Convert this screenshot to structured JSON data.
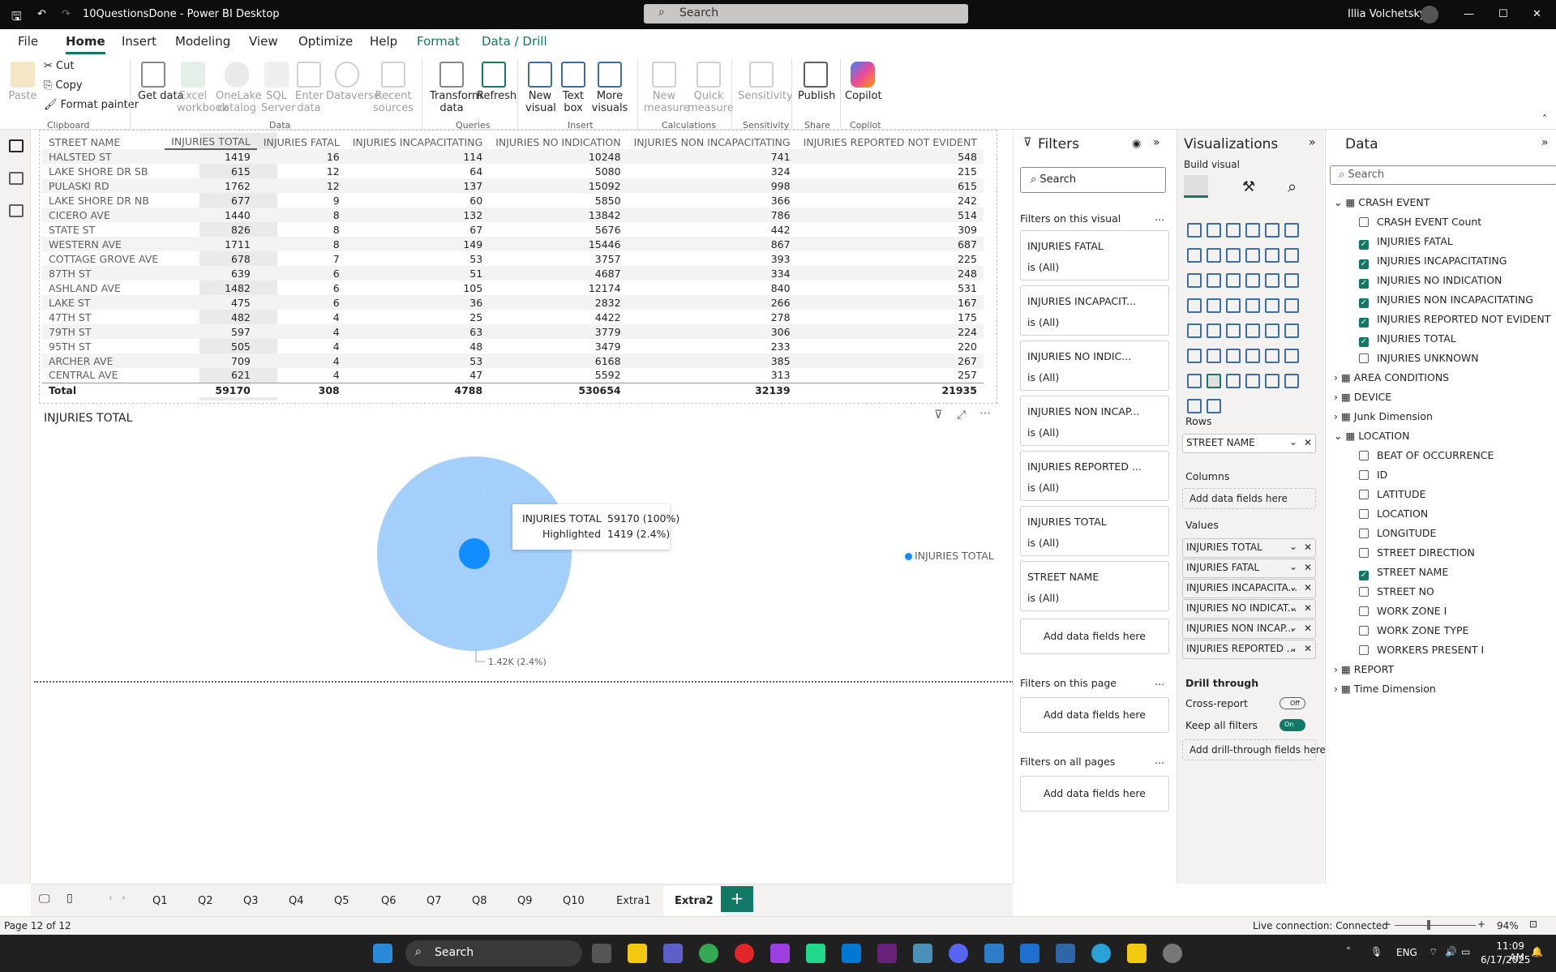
{
  "app": {
    "title": "10QuestionsDone - Power BI Desktop",
    "search": "Search",
    "user": "Illia Volchetskyi"
  },
  "ribbon_tabs": [
    "File",
    "Home",
    "Insert",
    "Modeling",
    "View",
    "Optimize",
    "Help",
    "Format",
    "Data / Drill"
  ],
  "ribbon": {
    "clipboard": {
      "paste": "Paste",
      "cut": "Cut",
      "copy": "Copy",
      "format_painter": "Format painter",
      "label": "Clipboard"
    },
    "data": {
      "get_data": "Get data",
      "excel": "Excel workbook",
      "onelake": "OneLake catalog",
      "sql": "SQL Server",
      "enter": "Enter data",
      "dataverse": "Dataverse",
      "recent": "Recent sources",
      "label": "Data"
    },
    "queries": {
      "transform": "Transform data",
      "refresh": "Refresh",
      "label": "Queries"
    },
    "insert": {
      "new_visual": "New visual",
      "text_box": "Text box",
      "more_visuals": "More visuals",
      "label": "Insert"
    },
    "calc": {
      "new_measure": "New measure",
      "quick_measure": "Quick measure",
      "label": "Calculations"
    },
    "sensitivity": {
      "btn": "Sensitivity",
      "label": "Sensitivity"
    },
    "share": {
      "publish": "Publish",
      "label": "Share"
    },
    "copilot": {
      "btn": "Copilot",
      "label": "Copilot"
    }
  },
  "table": {
    "headers": [
      "STREET NAME",
      "INJURIES TOTAL",
      "INJURIES FATAL",
      "INJURIES INCAPACITATING",
      "INJURIES NO INDICATION",
      "INJURIES NON INCAPACITATING",
      "INJURIES REPORTED NOT EVIDENT"
    ],
    "rows": [
      [
        "HALSTED ST",
        "1419",
        "16",
        "114",
        "10248",
        "741",
        "548"
      ],
      [
        "LAKE SHORE DR SB",
        "615",
        "12",
        "64",
        "5080",
        "324",
        "215"
      ],
      [
        "PULASKI RD",
        "1762",
        "12",
        "137",
        "15092",
        "998",
        "615"
      ],
      [
        "LAKE SHORE DR NB",
        "677",
        "9",
        "60",
        "5850",
        "366",
        "242"
      ],
      [
        "CICERO AVE",
        "1440",
        "8",
        "132",
        "13842",
        "786",
        "514"
      ],
      [
        "STATE ST",
        "826",
        "8",
        "67",
        "5676",
        "442",
        "309"
      ],
      [
        "WESTERN AVE",
        "1711",
        "8",
        "149",
        "15446",
        "867",
        "687"
      ],
      [
        "COTTAGE GROVE AVE",
        "678",
        "7",
        "53",
        "3757",
        "393",
        "225"
      ],
      [
        "87TH ST",
        "639",
        "6",
        "51",
        "4687",
        "334",
        "248"
      ],
      [
        "ASHLAND AVE",
        "1482",
        "6",
        "105",
        "12174",
        "840",
        "531"
      ],
      [
        "LAKE ST",
        "475",
        "6",
        "36",
        "2832",
        "266",
        "167"
      ],
      [
        "47TH ST",
        "482",
        "4",
        "25",
        "4422",
        "278",
        "175"
      ],
      [
        "79TH ST",
        "597",
        "4",
        "63",
        "3779",
        "306",
        "224"
      ],
      [
        "95TH ST",
        "505",
        "4",
        "48",
        "3479",
        "233",
        "220"
      ],
      [
        "ARCHER AVE",
        "709",
        "4",
        "53",
        "6168",
        "385",
        "267"
      ],
      [
        "CENTRAL AVE",
        "621",
        "4",
        "47",
        "5592",
        "313",
        "257"
      ]
    ],
    "total": [
      "Total",
      "59170",
      "308",
      "4788",
      "530654",
      "32139",
      "21935"
    ]
  },
  "pie": {
    "title": "INJURIES TOTAL",
    "legend": "INJURIES TOTAL",
    "tooltip": {
      "k1": "INJURIES TOTAL",
      "v1": "59170 (100%)",
      "k2": "Highlighted",
      "v2": "1419 (2.4%)"
    },
    "data_label": "1.42K (2.4%)",
    "colors": {
      "base": "#a3cffa",
      "highlight": "#118dff"
    }
  },
  "chart_data": {
    "type": "pie",
    "title": "INJURIES TOTAL",
    "total": 59170,
    "highlighted": 1419,
    "highlighted_pct": 2.4
  },
  "filters": {
    "title": "Filters",
    "search": "Search",
    "on_visual": "Filters on this visual",
    "cards": [
      {
        "name": "INJURIES FATAL",
        "value": "is (All)"
      },
      {
        "name": "INJURIES INCAPACIT...",
        "value": "is (All)"
      },
      {
        "name": "INJURIES NO INDIC...",
        "value": "is (All)"
      },
      {
        "name": "INJURIES NON INCAP...",
        "value": "is (All)"
      },
      {
        "name": "INJURIES REPORTED ...",
        "value": "is (All)"
      },
      {
        "name": "INJURIES TOTAL",
        "value": "is (All)"
      },
      {
        "name": "STREET NAME",
        "value": "is (All)"
      }
    ],
    "add": "Add data fields here",
    "on_page": "Filters on this page",
    "on_all": "Filters on all pages",
    "more": "..."
  },
  "viz": {
    "title": "Visualizations",
    "build": "Build visual",
    "rows_label": "Rows",
    "rows_field": "STREET NAME",
    "columns_label": "Columns",
    "add": "Add data fields here",
    "values_label": "Values",
    "values": [
      "INJURIES TOTAL",
      "INJURIES FATAL",
      "INJURIES INCAPACITA...",
      "INJURIES NO INDICAT...",
      "INJURIES NON INCAP...",
      "INJURIES REPORTED ..."
    ],
    "drill": "Drill through",
    "cross": "Cross-report",
    "cross_state": "Off",
    "keep": "Keep all filters",
    "keep_state": "On",
    "add_drill": "Add drill-through fields here"
  },
  "data_pane": {
    "title": "Data",
    "search": "Search",
    "tables": [
      {
        "name": "CRASH EVENT",
        "expanded": true,
        "fields": [
          {
            "name": "CRASH EVENT Count",
            "checked": false
          },
          {
            "name": "INJURIES FATAL",
            "checked": true
          },
          {
            "name": "INJURIES INCAPACITATING",
            "checked": true
          },
          {
            "name": "INJURIES NO INDICATION",
            "checked": true
          },
          {
            "name": "INJURIES NON INCAPACITATING",
            "checked": true
          },
          {
            "name": "INJURIES REPORTED NOT EVIDENT",
            "checked": true
          },
          {
            "name": "INJURIES TOTAL",
            "checked": true
          },
          {
            "name": "INJURIES UNKNOWN",
            "checked": false
          }
        ]
      },
      {
        "name": "AREA CONDITIONS",
        "expanded": false
      },
      {
        "name": "DEVICE",
        "expanded": false
      },
      {
        "name": "Junk Dimension",
        "expanded": false
      },
      {
        "name": "LOCATION",
        "expanded": true,
        "fields": [
          {
            "name": "BEAT OF OCCURRENCE",
            "checked": false
          },
          {
            "name": "ID",
            "checked": false
          },
          {
            "name": "LATITUDE",
            "checked": false
          },
          {
            "name": "LOCATION",
            "checked": false
          },
          {
            "name": "LONGITUDE",
            "checked": false
          },
          {
            "name": "STREET DIRECTION",
            "checked": false
          },
          {
            "name": "STREET NAME",
            "checked": true
          },
          {
            "name": "STREET NO",
            "checked": false
          },
          {
            "name": "WORK ZONE I",
            "checked": false
          },
          {
            "name": "WORK ZONE TYPE",
            "checked": false
          },
          {
            "name": "WORKERS PRESENT I",
            "checked": false
          }
        ]
      },
      {
        "name": "REPORT",
        "expanded": false
      },
      {
        "name": "Time Dimension",
        "expanded": false
      }
    ]
  },
  "pages": [
    "Q1",
    "Q2",
    "Q3",
    "Q4",
    "Q5",
    "Q6",
    "Q7",
    "Q8",
    "Q9",
    "Q10",
    "Extra1",
    "Extra2"
  ],
  "active_page": "Extra2",
  "status": {
    "page": "Page 12 of 12",
    "connection": "Live connection: Connected",
    "zoom": "94%"
  },
  "taskbar": {
    "search": "Search",
    "lang": "ENG",
    "time": "11:09 AM",
    "date": "6/17/2025"
  },
  "colors": {
    "accent": "#117865",
    "pbi_yellow": "#f2c811"
  }
}
